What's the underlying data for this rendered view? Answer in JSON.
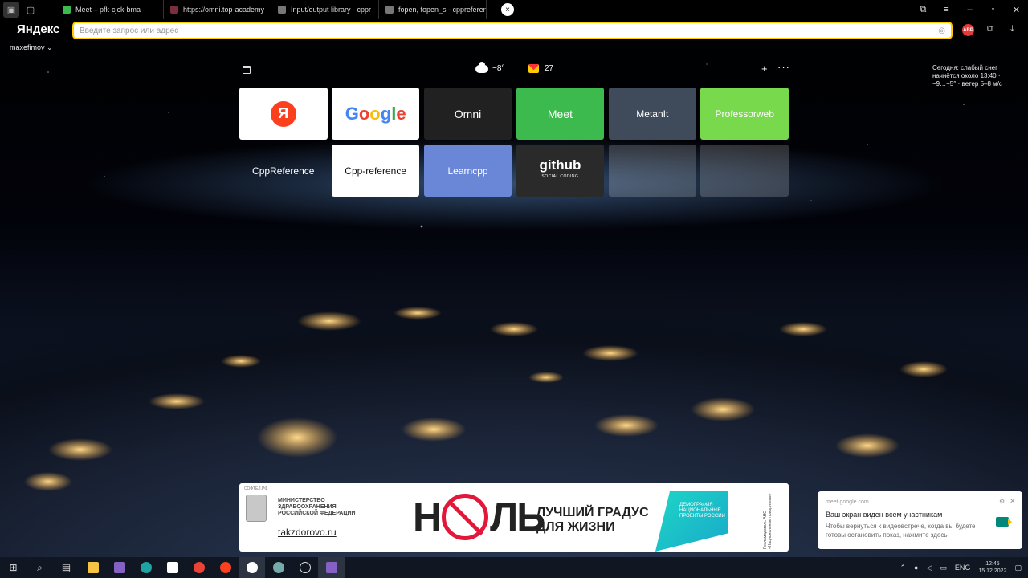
{
  "browser": {
    "tabs": [
      {
        "label": "Meet – pfk-cjck-bma",
        "color": "#3dba4e"
      },
      {
        "label": "https://omni.top-academy",
        "color": "#7a2e3e"
      },
      {
        "label": "Input/output library - cppr",
        "color": "#777777"
      },
      {
        "label": "fopen, fopen_s - cppreferen",
        "color": "#777777"
      }
    ],
    "active_tab_close": "×",
    "logo": "Яндекс",
    "address_placeholder": "Введите запрос или адрес",
    "profile": "maxefimov ⌄",
    "abp_label": "ABP"
  },
  "newtab": {
    "weather_temp": "−8°",
    "mail_count": "27",
    "add_label": "+",
    "more_label": "···",
    "forecast": "Сегодня: слабый снег начнётся около 13:40 · −9…−5° · ветер 5–8 м/с",
    "tiles": [
      {
        "label": "Я"
      },
      {
        "label": "Google"
      },
      {
        "label": "Omni"
      },
      {
        "label": "Meet"
      },
      {
        "label": "MetanIt"
      },
      {
        "label": "Professorweb"
      },
      {
        "label": "CppReference"
      },
      {
        "label": "Cpp-reference"
      },
      {
        "label": "Learncpp"
      },
      {
        "label": "github",
        "sub": "SOCIAL CODING"
      },
      {
        "label": ""
      },
      {
        "label": ""
      }
    ]
  },
  "banner": {
    "tiny": "СОФТЕЛ.РФ",
    "ministry": "МИНИСТЕРСТВО ЗДРАВООХРАНЕНИЯ РОССИЙСКОЙ ФЕДЕРАЦИИ",
    "site": "takzdorovo.ru",
    "nol_left": "Н",
    "nol_right": "ЛЬ",
    "slogan_1": "ЛУЧШИЙ ГРАДУС",
    "slogan_2": "ДЛЯ ЖИЗНИ",
    "natproj": "ДЕМОГРАФИЯ НАЦИОНАЛЬНЫЕ ПРОЕКТЫ РОССИИ",
    "vertical": "Рекламодатель АНО «Национальные приоритеты»"
  },
  "notification": {
    "source": "meet.google.com",
    "title": "Ваш экран виден всем участникам",
    "text": "Чтобы вернуться к видеовстрече, когда вы будете готовы остановить показ, нажмите здесь"
  },
  "taskbar": {
    "lang": "ENG",
    "time": "12:45",
    "date": "15.12.2022"
  },
  "colors": {
    "accent": "#ffcc00",
    "yandex_red": "#fc3f1d",
    "meet_green": "#3dba4e"
  }
}
